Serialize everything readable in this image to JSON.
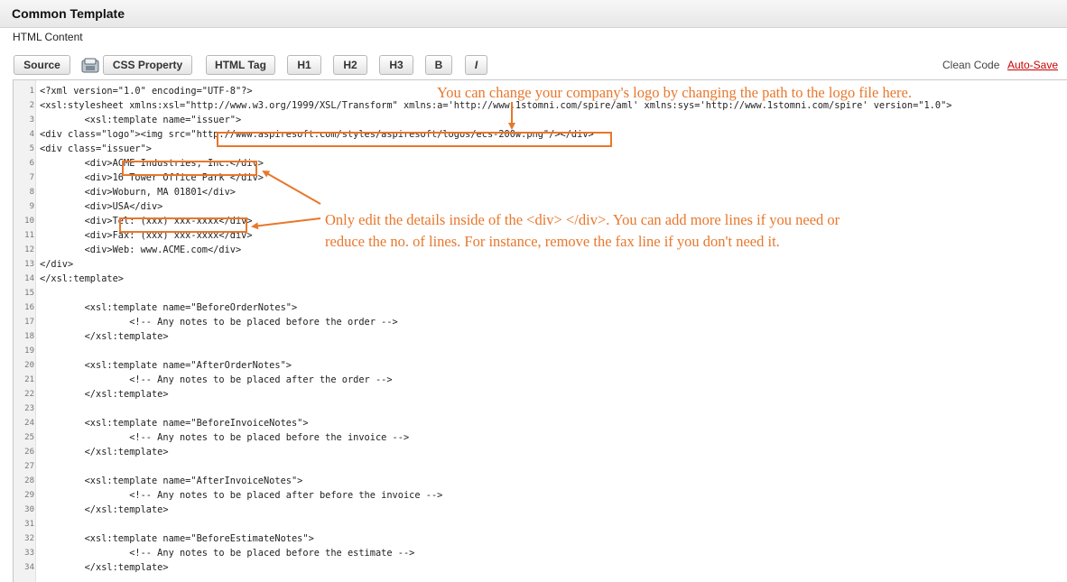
{
  "window": {
    "title": "Common Template",
    "subtitle": "HTML Content"
  },
  "toolbar": {
    "buttons": [
      "Source",
      "CSS Property",
      "HTML Tag",
      "H1",
      "H2",
      "H3",
      "B",
      "I"
    ],
    "clean_code": "Clean Code",
    "auto_save": "Auto-Save"
  },
  "code": [
    "<?xml version=\"1.0\" encoding=\"UTF-8\"?>",
    "<xsl:stylesheet xmlns:xsl=\"http://www.w3.org/1999/XSL/Transform\" xmlns:a='http://www.1stomni.com/spire/aml' xmlns:sys='http://www.1stomni.com/spire' version=\"1.0\">",
    "        <xsl:template name=\"issuer\">",
    "<div class=\"logo\"><img src=\"http://www.aspiresoft.com/styles/aspiresoft/logos/ecs-200w.png\"/></div>",
    "<div class=\"issuer\">",
    "        <div>ACME Industries, Inc.</div>",
    "        <div>16 Tower Office Park </div>",
    "        <div>Woburn, MA 01801</div>",
    "        <div>USA</div>",
    "        <div>Tel: (xxx) xxx-xxxx</div>",
    "        <div>Fax: (xxx) xxx-xxxx</div>",
    "        <div>Web: www.ACME.com</div>",
    "</div>",
    "</xsl:template>",
    "",
    "        <xsl:template name=\"BeforeOrderNotes\">",
    "                <!-- Any notes to be placed before the order -->",
    "        </xsl:template>",
    "",
    "        <xsl:template name=\"AfterOrderNotes\">",
    "                <!-- Any notes to be placed after the order -->",
    "        </xsl:template>",
    "",
    "        <xsl:template name=\"BeforeInvoiceNotes\">",
    "                <!-- Any notes to be placed before the invoice -->",
    "        </xsl:template>",
    "",
    "        <xsl:template name=\"AfterInvoiceNotes\">",
    "                <!-- Any notes to be placed after before the invoice -->",
    "        </xsl:template>",
    "",
    "        <xsl:template name=\"BeforeEstimateNotes\">",
    "                <!-- Any notes to be placed before the estimate -->",
    "        </xsl:template>"
  ],
  "annotations": {
    "logo": "You can change your company's logo by changing the path to the logo file here.",
    "div_line1": "Only edit the details inside of the <div> </div>.  You can add more lines if you need or",
    "div_line2": "reduce the no. of lines. For instance, remove the fax line if you don't need it."
  },
  "colors": {
    "annotation": "#e8772c",
    "autosave": "#cc0000"
  }
}
